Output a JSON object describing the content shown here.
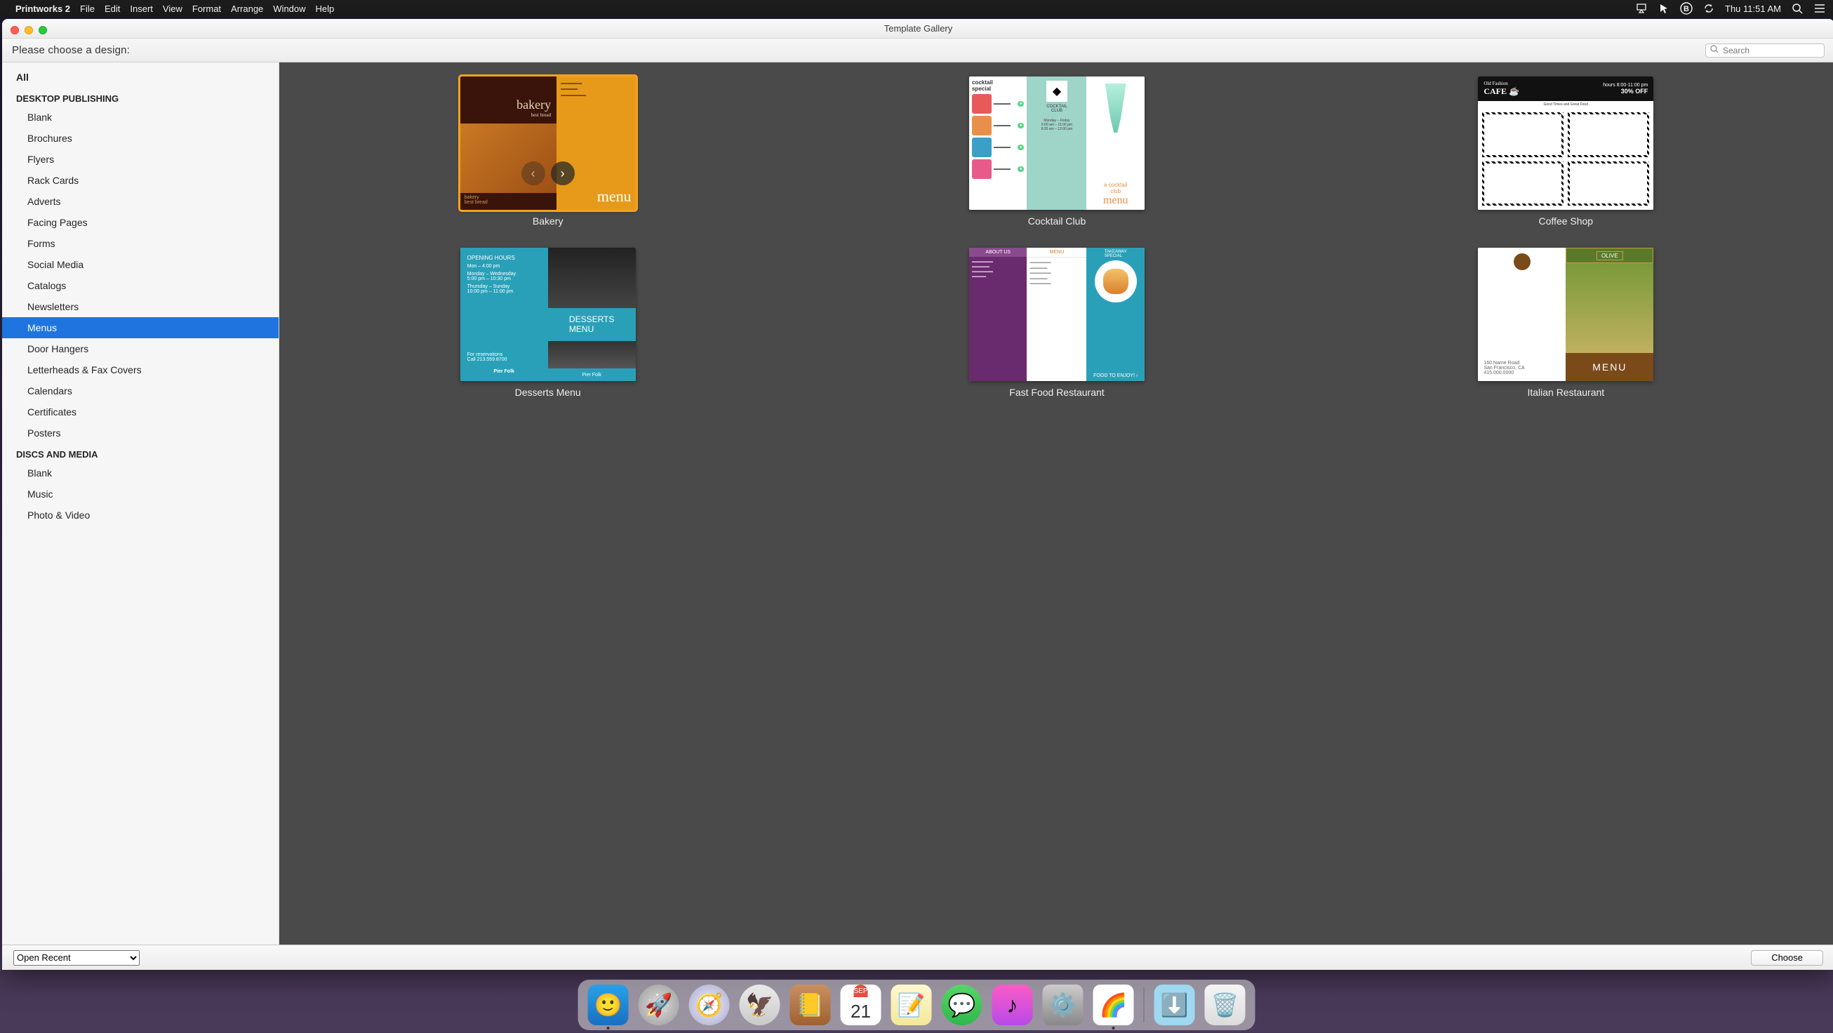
{
  "menubar": {
    "app_name": "Printworks 2",
    "items": [
      "File",
      "Edit",
      "Insert",
      "View",
      "Format",
      "Arrange",
      "Window",
      "Help"
    ],
    "clock": "Thu 11:51 AM"
  },
  "window": {
    "title": "Template Gallery",
    "prompt": "Please choose a design:",
    "search_placeholder": "Search"
  },
  "sidebar": {
    "top": "All",
    "groups": [
      {
        "header": "DESKTOP PUBLISHING",
        "items": [
          "Blank",
          "Brochures",
          "Flyers",
          "Rack Cards",
          "Adverts",
          "Facing Pages",
          "Forms",
          "Social Media",
          "Catalogs",
          "Newsletters",
          "Menus",
          "Door Hangers",
          "Letterheads & Fax Covers",
          "Calendars",
          "Certificates",
          "Posters"
        ]
      },
      {
        "header": "DISCS AND MEDIA",
        "items": [
          "Blank",
          "Music",
          "Photo & Video"
        ]
      }
    ],
    "selected": "Menus"
  },
  "templates": [
    {
      "name": "Bakery",
      "selected": true
    },
    {
      "name": "Cocktail Club",
      "selected": false
    },
    {
      "name": "Coffee Shop",
      "selected": false
    },
    {
      "name": "Desserts Menu",
      "selected": false
    },
    {
      "name": "Fast Food Restaurant",
      "selected": false
    },
    {
      "name": "Italian Restaurant",
      "selected": false
    }
  ],
  "footer": {
    "open_recent": "Open Recent",
    "choose": "Choose"
  },
  "dock": {
    "cal_month": "SEP",
    "cal_day": "21"
  }
}
